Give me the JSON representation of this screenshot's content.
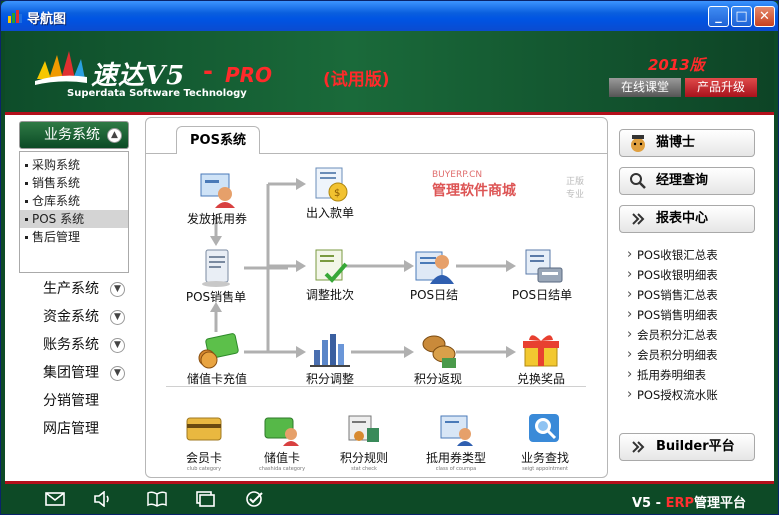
{
  "window": {
    "title": "导航图"
  },
  "header": {
    "brand": "速达V5",
    "dash": "-",
    "pro": "PRO",
    "trial": "(试用版)",
    "company": "Superdata Software Technology",
    "year": "2013版",
    "online_class": "在线课堂",
    "upgrade": "产品升级"
  },
  "sidebar": {
    "active_group": "业务系统",
    "sub_items": [
      "采购系统",
      "销售系统",
      "仓库系统",
      "POS 系统",
      "售后管理"
    ],
    "selected_sub": "POS 系统",
    "groups": [
      "生产系统",
      "资金系统",
      "账务系统",
      "集团管理",
      "分销管理",
      "网店管理"
    ]
  },
  "main": {
    "tab": "POS系统",
    "watermark_top": "BUYERP.CN",
    "watermark_name": "管理软件商城",
    "watermark_side1": "正版",
    "watermark_side2": "专业",
    "flow": {
      "issue_voucher": "发放抵用券",
      "in_out_slip": "出入款单",
      "pos_sales": "POS销售单",
      "adjust_batch": "调整批次",
      "pos_daily": "POS日结",
      "pos_daily_slip": "POS日结单",
      "card_topup": "储值卡充值",
      "points_adjust": "积分调整",
      "points_return": "积分返现",
      "redeem_prize": "兑换奖品"
    },
    "quick": [
      {
        "label": "会员卡",
        "sub": "club category"
      },
      {
        "label": "储值卡",
        "sub": "chashida category"
      },
      {
        "label": "积分规则",
        "sub": "stat check"
      },
      {
        "label": "抵用券类型",
        "sub": "class of coumpa"
      },
      {
        "label": "业务查找",
        "sub": "seigt appointment"
      }
    ]
  },
  "right": {
    "mascot": "猫博士",
    "manager_query": "经理查询",
    "report_center": "报表中心",
    "reports": [
      "POS收银汇总表",
      "POS收银明细表",
      "POS销售汇总表",
      "POS销售明细表",
      "会员积分汇总表",
      "会员积分明细表",
      "抵用券明细表",
      "POS授权流水账"
    ],
    "builder": "Builder平台"
  },
  "footer": {
    "prefix": "V5 -",
    "erp": "ERP",
    "suffix": "管理平台",
    "icons": [
      "mail-icon",
      "speaker-icon",
      "book-icon",
      "windows-icon",
      "check-icon"
    ]
  },
  "colors": {
    "green": "#0d4a26",
    "red": "#b3101b",
    "titlebar": "#0054e3"
  }
}
